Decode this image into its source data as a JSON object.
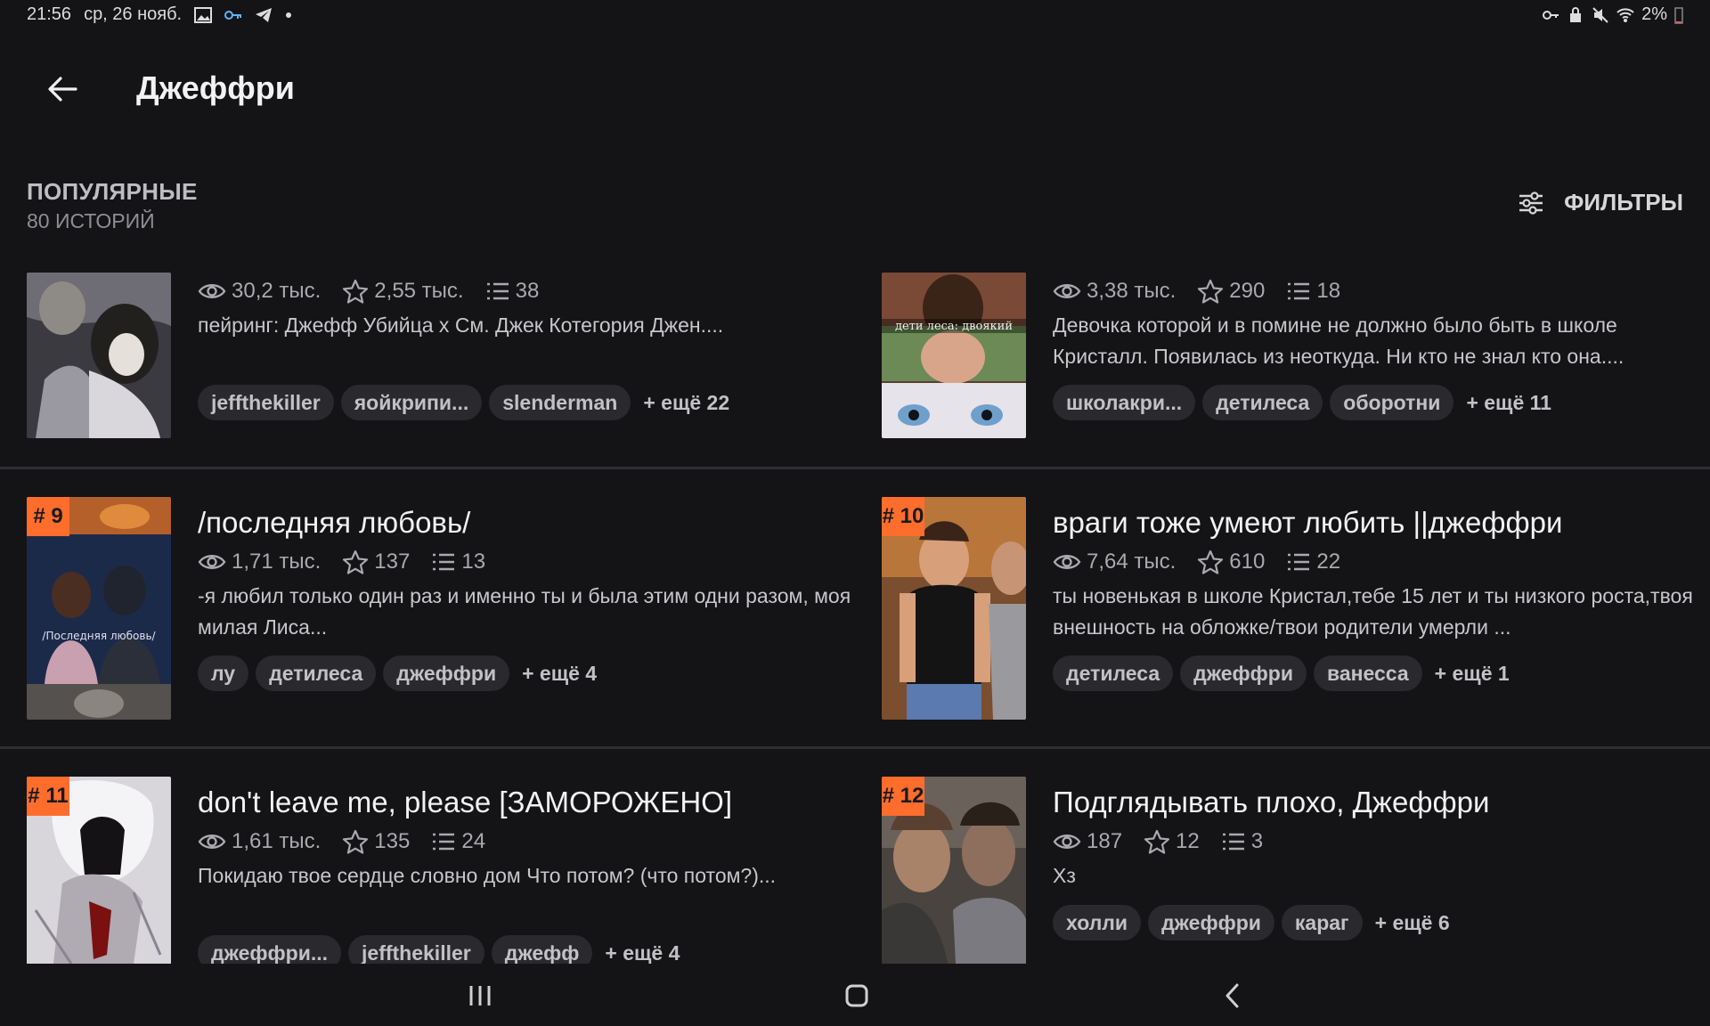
{
  "status": {
    "time": "21:56",
    "date": "ср, 26 нояб.",
    "battery": "2%"
  },
  "header": {
    "title": "Джеффри"
  },
  "section": {
    "title": "ПОПУЛЯРНЫЕ",
    "count": "80 ИСТОРИЙ",
    "filters_label": "ФИЛЬТРЫ"
  },
  "stories": [
    {
      "rank": "",
      "title": "",
      "views": "30,2 тыс.",
      "stars": "2,55 тыс.",
      "parts": "38",
      "desc": "пейринг: Джефф Убийца х См. Джек Котегория Джен....",
      "tags": [
        "jeffthekiller",
        "яойкрипи...",
        "slenderman"
      ],
      "more": "+ ещё 22"
    },
    {
      "rank": "",
      "title": "",
      "views": "3,38 тыс.",
      "stars": "290",
      "parts": "18",
      "desc": "Девочка которой и в помине не должно было быть в школе Кристалл. Появилась из неоткуда. Ни кто не знал кто она....",
      "tags": [
        "школакри...",
        "детилеса",
        "оборотни"
      ],
      "more": "+ ещё 11",
      "cover_caption": "дети леса: двоякий"
    },
    {
      "rank": "# 9",
      "title": "/последняя любовь/",
      "views": "1,71 тыс.",
      "stars": "137",
      "parts": "13",
      "desc": "-я любил только один раз и именно ты и была этим одни разом, моя милая Лиса...",
      "tags": [
        "лу",
        "детилеса",
        "джеффри"
      ],
      "more": "+ ещё 4",
      "cover_caption": "/Последняя любовь/"
    },
    {
      "rank": "# 10",
      "title": "враги тоже умеют любить ||джеффри",
      "views": "7,64 тыс.",
      "stars": "610",
      "parts": "22",
      "desc": "ты новенькая в школе Кристал,тебе 15 лет и ты низкого роста,твоя внешность на обложке/твои родители умерли ...",
      "tags": [
        "детилеса",
        "джеффри",
        "ванесса"
      ],
      "more": "+ ещё 1"
    },
    {
      "rank": "# 11",
      "title": "don't leave me, please [ЗАМОРОЖЕНО]",
      "views": "1,61 тыс.",
      "stars": "135",
      "parts": "24",
      "desc": "Покидаю твое сердце словно дом Что потом? (что потом?)...",
      "tags": [
        "джеффри...",
        "jeffthekiller",
        "джефф"
      ],
      "more": "+ ещё 4"
    },
    {
      "rank": "# 12",
      "title": "Подглядывать плохо, Джеффри",
      "views": "187",
      "stars": "12",
      "parts": "3",
      "desc": "Хз",
      "tags": [
        "холли",
        "джеффри",
        "караг"
      ],
      "more": "+ ещё 6"
    }
  ],
  "colors": {
    "accent": "#ff6d2d",
    "background": "#141316",
    "tag_bg": "#2a292d"
  }
}
